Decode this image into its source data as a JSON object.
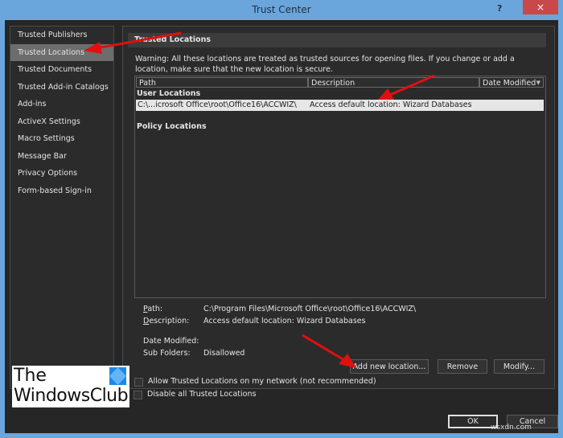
{
  "window": {
    "title": "Trust Center",
    "help_label": "?",
    "close_label": "×"
  },
  "sidebar": {
    "items": [
      {
        "label": "Trusted Publishers",
        "active": false
      },
      {
        "label": "Trusted Locations",
        "active": true
      },
      {
        "label": "Trusted Documents",
        "active": false
      },
      {
        "label": "Trusted Add-in Catalogs",
        "active": false
      },
      {
        "label": "Add-ins",
        "active": false
      },
      {
        "label": "ActiveX Settings",
        "active": false
      },
      {
        "label": "Macro Settings",
        "active": false
      },
      {
        "label": "Message Bar",
        "active": false
      },
      {
        "label": "Privacy Options",
        "active": false
      },
      {
        "label": "Form-based Sign-in",
        "active": false
      }
    ]
  },
  "main": {
    "section_title": "Trusted Locations",
    "warning": "Warning: All these locations are treated as trusted sources for opening files.  If you change or add a location, make sure that the new location is secure.",
    "list": {
      "columns": [
        "Path",
        "Description",
        "Date Modified"
      ],
      "groups": {
        "user": "User Locations",
        "policy": "Policy Locations"
      },
      "rows": [
        {
          "path": "C:\\...icrosoft Office\\root\\Office16\\ACCWIZ\\",
          "description": "Access default location: Wizard Databases",
          "date_modified": ""
        }
      ]
    },
    "details": {
      "path_label": "Path:",
      "path_value": "C:\\Program Files\\Microsoft Office\\root\\Office16\\ACCWIZ\\",
      "description_label": "Description:",
      "description_value": "Access default location: Wizard Databases",
      "date_modified_label": "Date Modified:",
      "date_modified_value": "",
      "subfolders_label": "Sub Folders:",
      "subfolders_value": "Disallowed"
    },
    "buttons": {
      "add": "Add new location...",
      "remove": "Remove",
      "modify": "Modify..."
    },
    "checkboxes": [
      {
        "label": "Allow Trusted Locations on my network (not recommended)",
        "checked": false
      },
      {
        "label": "Disable all Trusted Locations",
        "checked": false
      }
    ]
  },
  "footer": {
    "ok": "OK",
    "cancel": "Cancel"
  },
  "overlay": {
    "logo_line1": "The",
    "logo_line2": "WindowsClub",
    "watermark": "wsxdn.com"
  },
  "colors": {
    "titlebar": "#6aa6dc",
    "close": "#c9494a",
    "annotation_arrow": "#e01010"
  }
}
